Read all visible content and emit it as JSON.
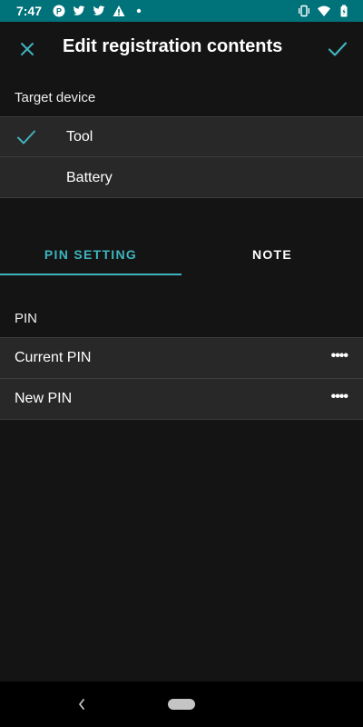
{
  "status_bar": {
    "time": "7:47",
    "icons_left": [
      "p-badge-icon",
      "twitter-icon",
      "twitter-icon",
      "warning-icon",
      "dot-icon"
    ],
    "icons_right": [
      "vibrate-icon",
      "wifi-icon",
      "battery-icon"
    ]
  },
  "app_bar": {
    "title": "Edit registration contents",
    "close_icon": "close-icon",
    "save_icon": "check-icon"
  },
  "target_device": {
    "label": "Target device",
    "options": [
      {
        "label": "Tool",
        "selected": true
      },
      {
        "label": "Battery",
        "selected": false
      }
    ]
  },
  "tabs": [
    {
      "label": "PIN SETTING",
      "active": true
    },
    {
      "label": "NOTE",
      "active": false
    }
  ],
  "pin": {
    "section_label": "PIN",
    "fields": [
      {
        "label": "Current PIN",
        "value": "••••"
      },
      {
        "label": "New PIN",
        "value": "••••"
      }
    ]
  },
  "colors": {
    "accent": "#3fb3bd",
    "status_bar": "#00727a",
    "background": "#141414",
    "row_background": "#282828"
  }
}
